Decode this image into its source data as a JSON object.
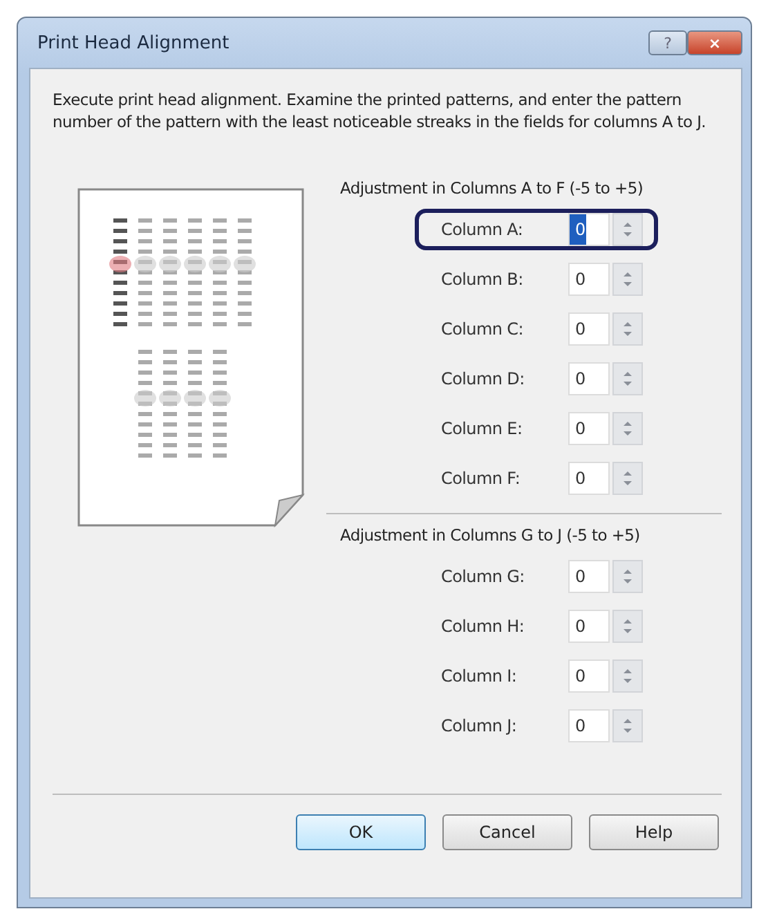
{
  "window": {
    "title": "Print Head Alignment",
    "help_button": "?",
    "close_button": "×"
  },
  "instructions": "Execute print head alignment. Examine the printed patterns, and enter the pattern number of the pattern with the least noticeable streaks in the fields for columns A to J.",
  "groups": [
    {
      "label": "Adjustment in Columns A to F (-5 to +5)",
      "fields": [
        {
          "label": "Column A:",
          "value": "0",
          "focused": true,
          "highlighted": true
        },
        {
          "label": "Column B:",
          "value": "0",
          "focused": false,
          "highlighted": false
        },
        {
          "label": "Column C:",
          "value": "0",
          "focused": false,
          "highlighted": false
        },
        {
          "label": "Column D:",
          "value": "0",
          "focused": false,
          "highlighted": false
        },
        {
          "label": "Column E:",
          "value": "0",
          "focused": false,
          "highlighted": false
        },
        {
          "label": "Column F:",
          "value": "0",
          "focused": false,
          "highlighted": false
        }
      ]
    },
    {
      "label": "Adjustment in Columns G to J (-5 to +5)",
      "fields": [
        {
          "label": "Column G:",
          "value": "0",
          "focused": false,
          "highlighted": false
        },
        {
          "label": "Column H:",
          "value": "0",
          "focused": false,
          "highlighted": false
        },
        {
          "label": "Column I:",
          "value": "0",
          "focused": false,
          "highlighted": false
        },
        {
          "label": "Column J:",
          "value": "0",
          "focused": false,
          "highlighted": false
        }
      ]
    }
  ],
  "buttons": [
    {
      "label": "OK",
      "default": true
    },
    {
      "label": "Cancel",
      "default": false
    },
    {
      "label": "Help",
      "default": false
    }
  ]
}
